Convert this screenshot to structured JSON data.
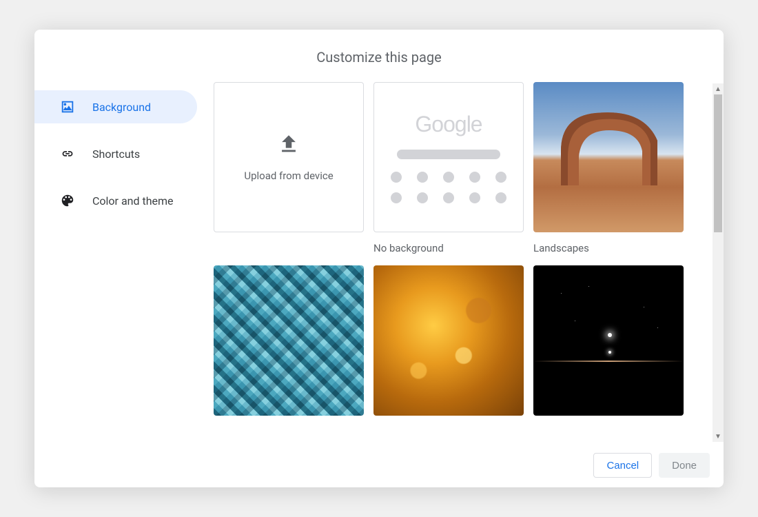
{
  "dialog": {
    "title": "Customize this page"
  },
  "sidebar": {
    "items": [
      {
        "label": "Background",
        "icon": "image-icon",
        "active": true
      },
      {
        "label": "Shortcuts",
        "icon": "link-icon",
        "active": false
      },
      {
        "label": "Color and theme",
        "icon": "palette-icon",
        "active": false
      }
    ]
  },
  "main": {
    "upload_label": "Upload from device",
    "tiles": [
      {
        "id": "upload",
        "type": "upload",
        "caption": ""
      },
      {
        "id": "no-background",
        "type": "nobg",
        "caption": "No background"
      },
      {
        "id": "landscapes",
        "type": "image",
        "caption": "Landscapes",
        "thumb": "landscape"
      },
      {
        "id": "textures",
        "type": "image",
        "caption": "",
        "thumb": "textures"
      },
      {
        "id": "life",
        "type": "image",
        "caption": "",
        "thumb": "life"
      },
      {
        "id": "earth",
        "type": "image",
        "caption": "",
        "thumb": "earth"
      }
    ],
    "google_placeholder_text": "Google"
  },
  "footer": {
    "cancel_label": "Cancel",
    "done_label": "Done"
  },
  "colors": {
    "accent": "#1a73e8",
    "active_bg": "#e8f0fe",
    "text_secondary": "#5f6368"
  }
}
